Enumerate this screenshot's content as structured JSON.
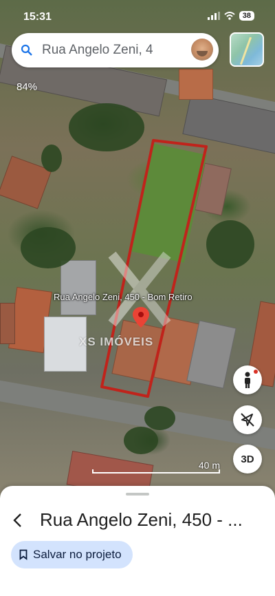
{
  "status_bar": {
    "time": "15:31",
    "battery": "38"
  },
  "search": {
    "text": "Rua Angelo Zeni, 4"
  },
  "map": {
    "zoom_percent": "84%",
    "pin_label": "Rua Angelo Zeni, 450 - Bom Retiro",
    "watermark_text": "XS IMÓVEIS",
    "scale_label": "40 m",
    "plot_outline_color": "#c0231b"
  },
  "controls": {
    "view_3d_label": "3D"
  },
  "sheet": {
    "title": "Rua Angelo Zeni, 450 - ...",
    "save_label": "Salvar no projeto"
  },
  "colors": {
    "accent_chip": "#d3e3fd",
    "pin": "#ea4335"
  }
}
